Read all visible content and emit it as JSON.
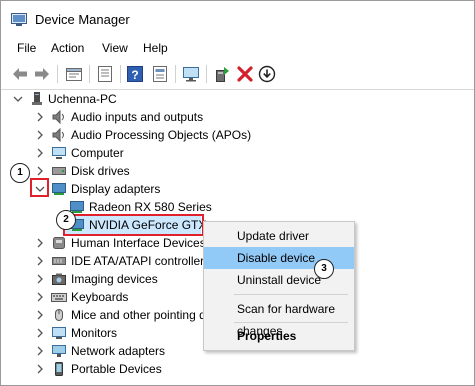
{
  "window": {
    "title": "Device Manager"
  },
  "menu": [
    "File",
    "Action",
    "View",
    "Help"
  ],
  "toolbar": {
    "icons": [
      "back-arrow-icon",
      "forward-arrow-icon",
      "properties-icon",
      "update-driver-icon",
      "help-icon",
      "scan-icon",
      "monitor-icon",
      "add-driver-icon",
      "uninstall-x-icon",
      "download-arrow-icon"
    ]
  },
  "tree": {
    "root": "Uchenna-PC",
    "items": [
      "Audio inputs and outputs",
      "Audio Processing Objects (APOs)",
      "Computer",
      "Disk drives",
      "Display adapters",
      "Radeon RX 580 Series",
      "NVIDIA GeForce GTX",
      "Human Interface Devices",
      "IDE ATA/ATAPI controllers",
      "Imaging devices",
      "Keyboards",
      "Mice and other pointing devices",
      "Monitors",
      "Network adapters",
      "Portable Devices"
    ]
  },
  "context_menu": {
    "update": "Update driver",
    "disable": "Disable device",
    "uninstall": "Uninstall device",
    "scan": "Scan for hardware changes",
    "properties": "Properties"
  },
  "callouts": [
    "1",
    "2",
    "3"
  ],
  "colors": {
    "highlight": "#91c9f7",
    "red_annotation": "#e0202a",
    "accent_green": "#2a9d3a"
  }
}
